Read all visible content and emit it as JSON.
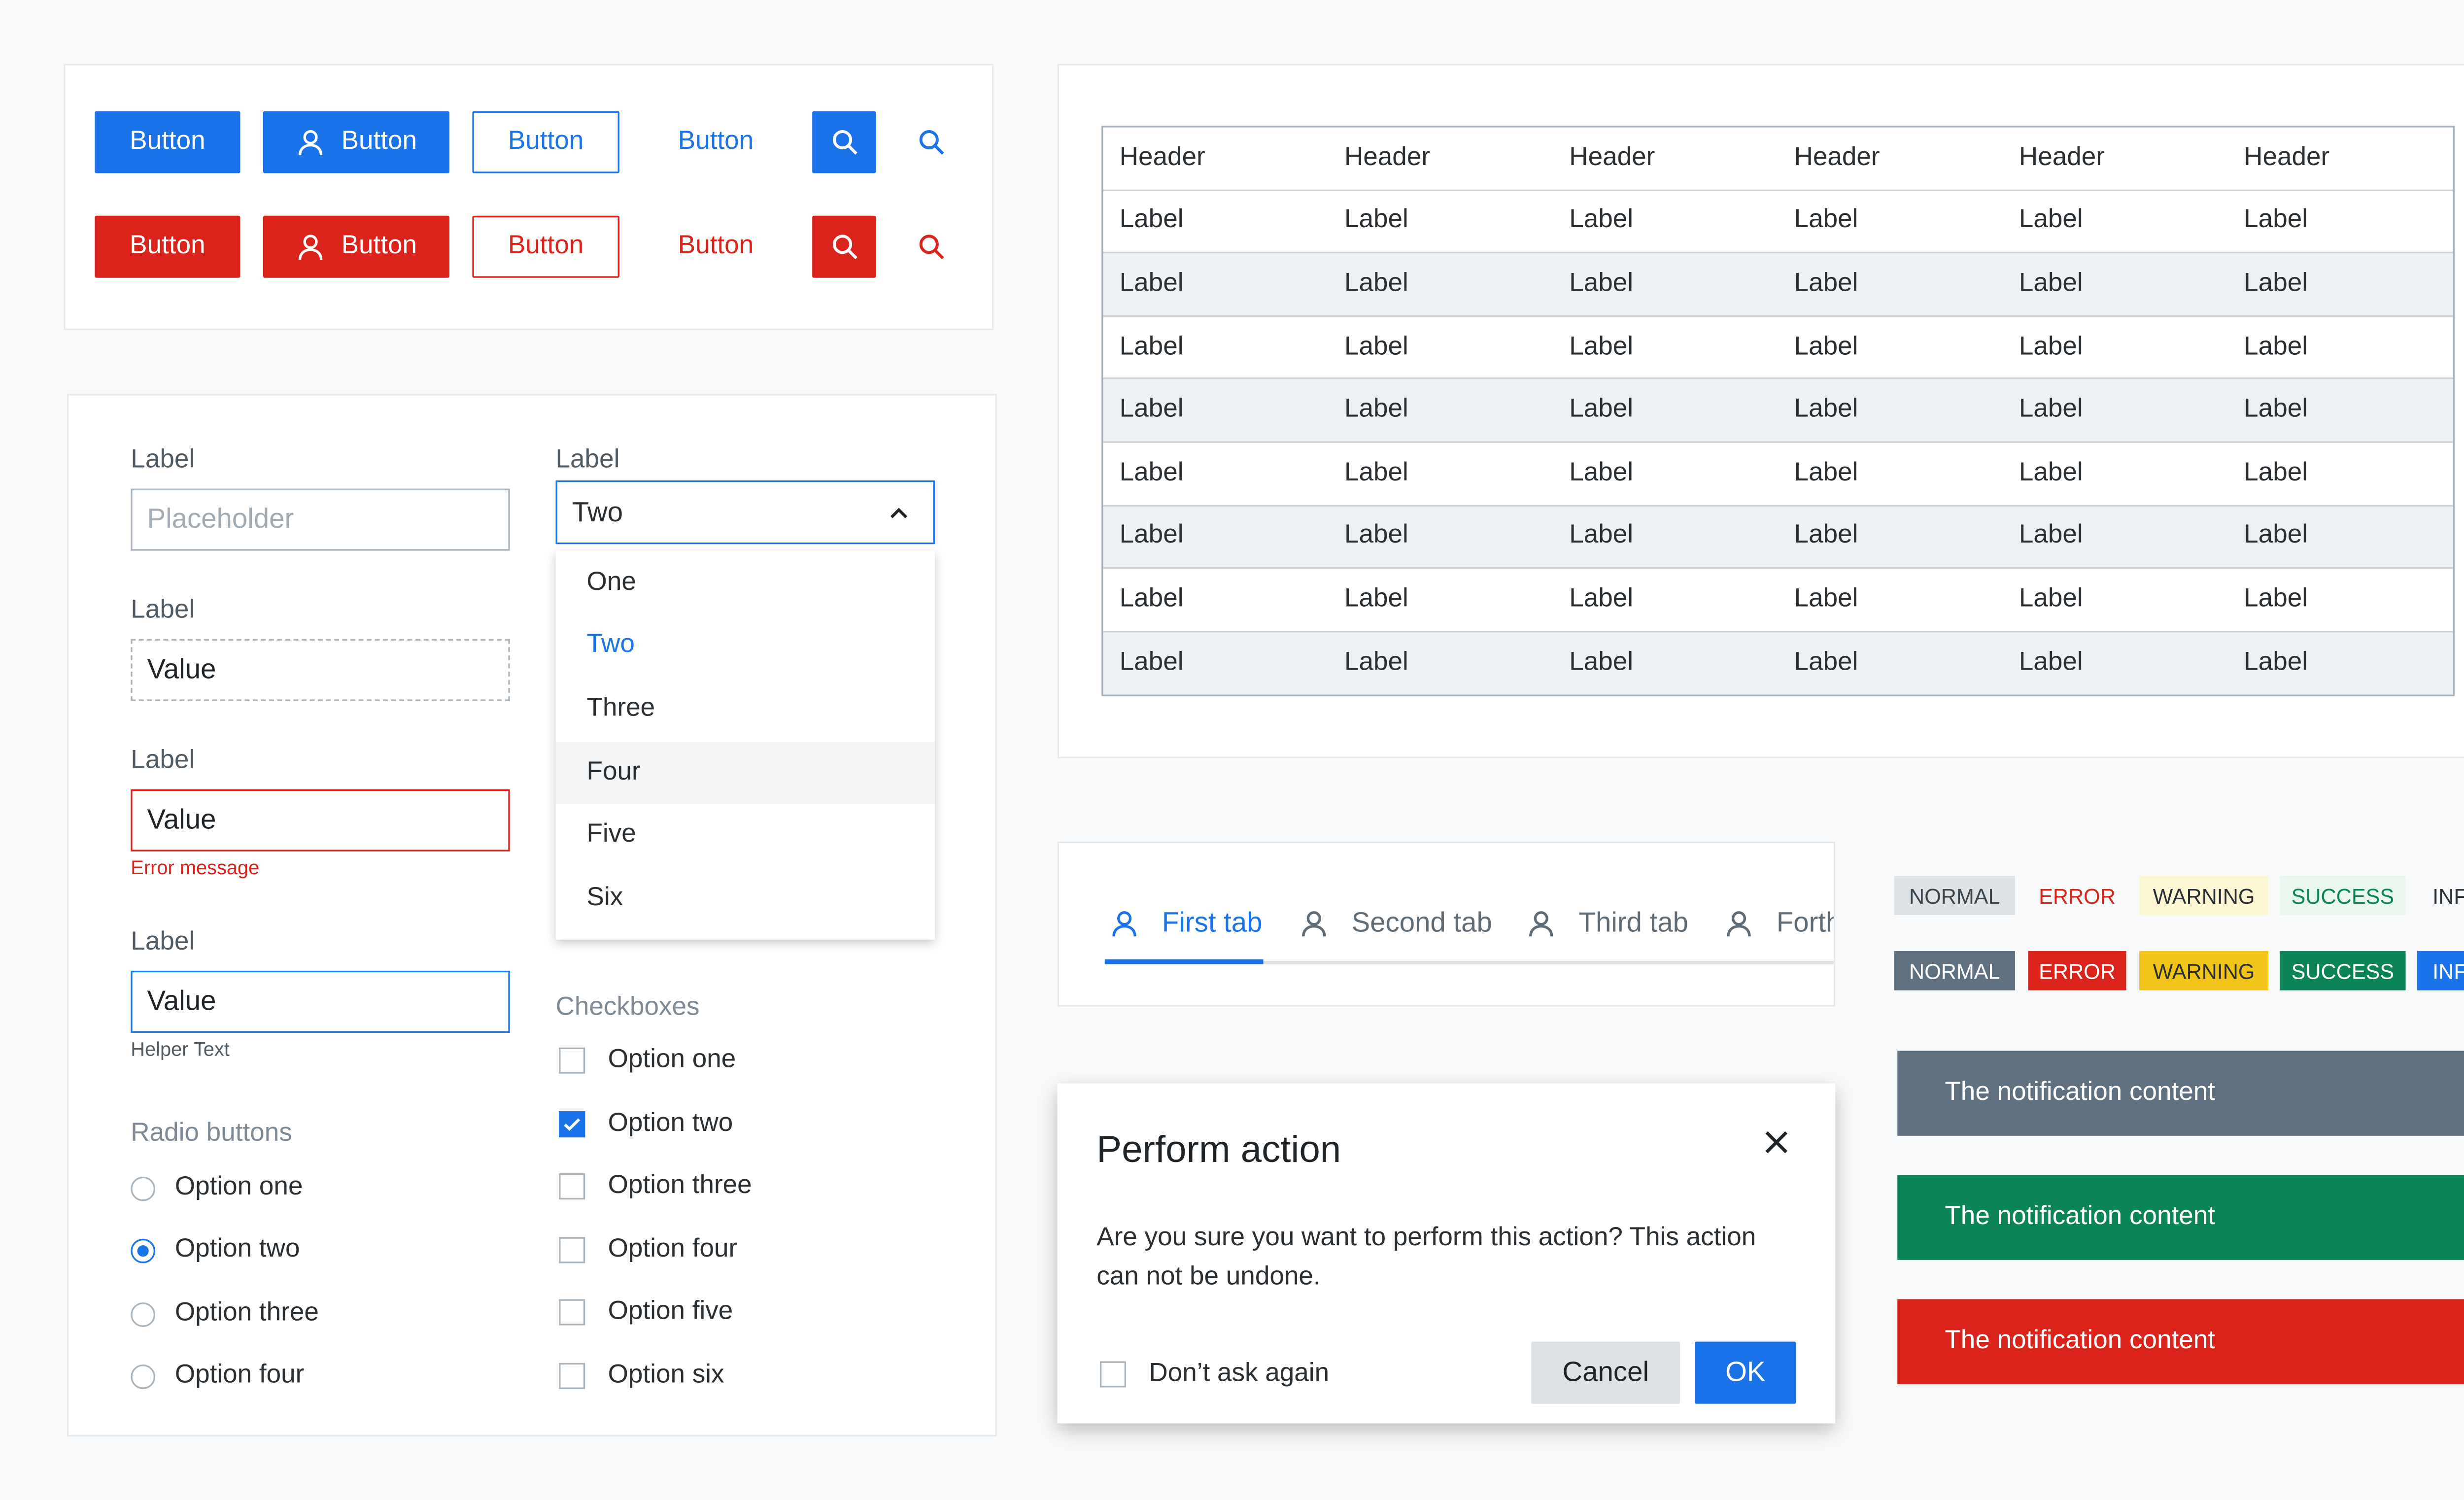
{
  "colors": {
    "primary": "#1a73e8",
    "danger": "#d9231b",
    "success": "#0b8457",
    "warning": "#f0c419",
    "neutral": "#5f7180"
  },
  "buttons": {
    "row1": {
      "primary": "Button",
      "primary_icon": "Button",
      "outline": "Button",
      "ghost": "Button"
    },
    "row2": {
      "primary": "Button",
      "primary_icon": "Button",
      "outline": "Button",
      "ghost": "Button"
    }
  },
  "form": {
    "text_label": "Label",
    "text_placeholder": "Placeholder",
    "dashed_label": "Label",
    "dashed_value": "Value",
    "error_label": "Label",
    "error_value": "Value",
    "error_message": "Error message",
    "focus_label": "Label",
    "focus_value": "Value",
    "helper_text": "Helper Text",
    "radio_title": "Radio buttons",
    "radios": [
      {
        "label": "Option one",
        "checked": false
      },
      {
        "label": "Option two",
        "checked": true
      },
      {
        "label": "Option three",
        "checked": false
      },
      {
        "label": "Option four",
        "checked": false
      }
    ],
    "select_label": "Label",
    "select_value": "Two",
    "select_options": [
      "One",
      "Two",
      "Three",
      "Four",
      "Five",
      "Six"
    ],
    "checkbox_title": "Checkboxes",
    "checkboxes": [
      {
        "label": "Option one",
        "checked": false
      },
      {
        "label": "Option two",
        "checked": true
      },
      {
        "label": "Option three",
        "checked": false
      },
      {
        "label": "Option four",
        "checked": false
      },
      {
        "label": "Option five",
        "checked": false
      },
      {
        "label": "Option six",
        "checked": false
      }
    ]
  },
  "table": {
    "headers": [
      "Header",
      "Header",
      "Header",
      "Header",
      "Header",
      "Header"
    ],
    "rows": [
      [
        "Label",
        "Label",
        "Label",
        "Label",
        "Label",
        "Label"
      ],
      [
        "Label",
        "Label",
        "Label",
        "Label",
        "Label",
        "Label"
      ],
      [
        "Label",
        "Label",
        "Label",
        "Label",
        "Label",
        "Label"
      ],
      [
        "Label",
        "Label",
        "Label",
        "Label",
        "Label",
        "Label"
      ],
      [
        "Label",
        "Label",
        "Label",
        "Label",
        "Label",
        "Label"
      ],
      [
        "Label",
        "Label",
        "Label",
        "Label",
        "Label",
        "Label"
      ],
      [
        "Label",
        "Label",
        "Label",
        "Label",
        "Label",
        "Label"
      ],
      [
        "Label",
        "Label",
        "Label",
        "Label",
        "Label",
        "Label"
      ]
    ]
  },
  "tabs": [
    {
      "label": "First tab",
      "active": true
    },
    {
      "label": "Second tab",
      "active": false
    },
    {
      "label": "Third tab",
      "active": false
    },
    {
      "label": "Forth",
      "active": false
    }
  ],
  "badges": {
    "light": [
      "NORMAL",
      "ERROR",
      "WARNING",
      "SUCCESS",
      "INFO"
    ],
    "solid": [
      "NORMAL",
      "ERROR",
      "WARNING",
      "SUCCESS",
      "INFO"
    ]
  },
  "notifications": [
    {
      "text": "The notification content",
      "color": "#5f7180"
    },
    {
      "text": "The notification content",
      "color": "#0b8457"
    },
    {
      "text": "The notification content",
      "color": "#d9231b"
    }
  ],
  "modal": {
    "title": "Perform action",
    "body": "Are you sure you want to perform this action? This action can not be undone.",
    "checkbox_label": "Don’t ask again",
    "cancel": "Cancel",
    "ok": "OK"
  }
}
